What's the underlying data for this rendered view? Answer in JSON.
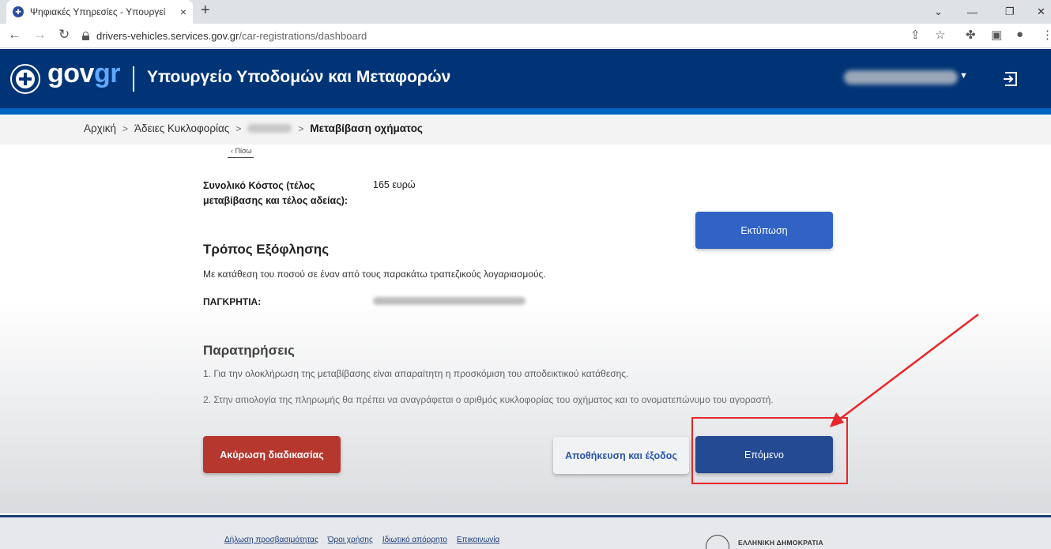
{
  "browser": {
    "tab_title": "Ψηφιακές Υπηρεσίες - Υπουργεί",
    "tab_close": "×",
    "new_tab": "+",
    "url_host": "drivers-vehicles.services.gov.gr",
    "url_path": "/car-registrations/dashboard"
  },
  "header": {
    "logo_main": "gov",
    "logo_accent": "gr",
    "ministry": "Υπουργείο Υποδομών και Μεταφορών"
  },
  "breadcrumb": {
    "home": "Αρχική",
    "licenses": "Άδειες Κυκλοφορίας",
    "current": "Μεταβίβαση οχήματος"
  },
  "main": {
    "back": "‹ Πίσω",
    "cost_label": "Συνολικό Κόστος (τέλος μεταβίβασης και τέλος αδείας):",
    "cost_value": "165 ευρώ",
    "print_button": "Εκτύπωση",
    "payment_title": "Τρόπος Εξόφλησης",
    "payment_text": "Με κατάθεση του ποσού σε έναν από τους παρακάτω τραπεζικούς λογαριασμούς.",
    "bank_label": "ΠΑΓΚΡΗΤΙΑ:",
    "notes_title": "Παρατηρήσεις",
    "note_1": "1. Για την ολοκλήρωση της μεταβίβασης είναι απαραίτητη η προσκόμιση του αποδεικτικού κατάθεσης.",
    "note_2": "2. Στην αιτιολογία της πληρωμής θα πρέπει να αναγράφεται ο αριθμός κυκλοφορίας του οχήματος και το ονοματεπώνυμο του αγοραστή.",
    "cancel_button": "Ακύρωση διαδικασίας",
    "save_button": "Αποθήκευση και έξοδος",
    "next_button": "Επόμενο"
  },
  "footer": {
    "links": [
      "Δήλωση προσβασιμότητας",
      "Όροι χρήσης",
      "Ιδιωτικό απόρρητο",
      "Επικοινωνία"
    ],
    "brand": "ΕΛΛΗΝΙΚΗ ΔΗΜΟΚΡΑΤΙΑ"
  },
  "colors": {
    "header_bg": "#003476",
    "primary_button": "#3063c4",
    "danger_button": "#b5372d",
    "annotation": "#e8262a"
  }
}
